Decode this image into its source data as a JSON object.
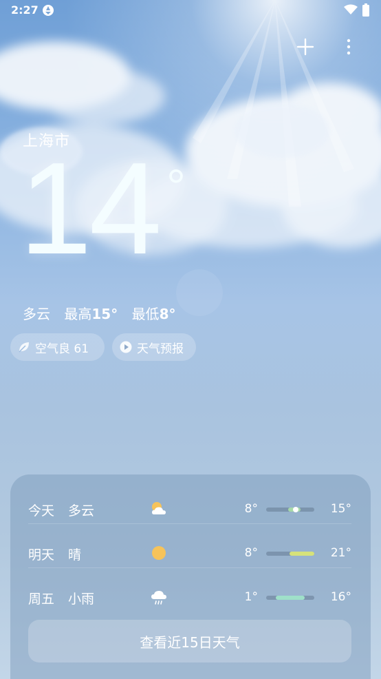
{
  "status_bar": {
    "time": "2:27"
  },
  "header": {
    "city": "上海市"
  },
  "current": {
    "temperature": "14",
    "unit": "°",
    "condition": "多云",
    "high_label": "最高",
    "high": "15°",
    "low_label": "最低",
    "low": "8°"
  },
  "chips": {
    "air_quality": "空气良 61",
    "forecast_video": "天气预报"
  },
  "forecast": [
    {
      "day": "今天",
      "condition": "多云",
      "icon": "partly-cloudy-icon",
      "low": "8°",
      "high": "15°",
      "range_start": 0.45,
      "range_end": 0.72,
      "current": 0.62,
      "bar_color": "#a6d9a8"
    },
    {
      "day": "明天",
      "condition": "晴",
      "icon": "sun-icon",
      "low": "8°",
      "high": "21°",
      "range_start": 0.48,
      "range_end": 1.0,
      "bar_color": "#d6e27a"
    },
    {
      "day": "周五",
      "condition": "小雨",
      "icon": "light-rain-icon",
      "low": "1°",
      "high": "16°",
      "range_start": 0.2,
      "range_end": 0.8,
      "bar_color": "#9fe0c9"
    }
  ],
  "more_days_button": "查看近15日天气",
  "colors": {
    "accent_sun": "#f6c35a",
    "bar_track": "#5a6e87"
  }
}
